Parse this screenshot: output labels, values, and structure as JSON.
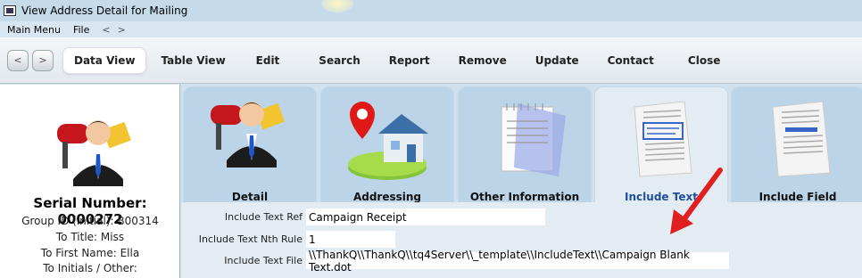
{
  "window": {
    "title": "View Address Detail for Mailing"
  },
  "menu": {
    "main": "Main Menu",
    "file": "File",
    "back": "<",
    "forward": ">"
  },
  "toolbar": {
    "back": "<",
    "forward": ">",
    "data_view": "Data View",
    "table_view": "Table View",
    "edit": "Edit",
    "search": "Search",
    "report": "Report",
    "remove": "Remove",
    "update": "Update",
    "contact": "Contact",
    "close": "Close"
  },
  "left": {
    "serial": "Serial Number: 0000272",
    "group_id": "Group ID (initial): B00314",
    "to_title": "To Title: Miss",
    "first_name": "To First Name: Ella",
    "initials": "To Initials / Other:"
  },
  "tabs": [
    {
      "label": "Detail"
    },
    {
      "label": "Addressing"
    },
    {
      "label": "Other Information"
    },
    {
      "label": "Include Text"
    },
    {
      "label": "Include Field"
    }
  ],
  "form": {
    "ref_label": "Include Text Ref",
    "ref_value": "Campaign Receipt",
    "rule_label": "Include Text Nth Rule",
    "rule_value": "1",
    "file_label": "Include Text File",
    "file_value": "\\\\ThankQ\\\\ThankQ\\\\tq4Server\\\\_template\\\\IncludeText\\\\Campaign Blank Text.dot"
  },
  "colors": {
    "accent": "#1e4f9a",
    "arrow": "#e02020"
  }
}
